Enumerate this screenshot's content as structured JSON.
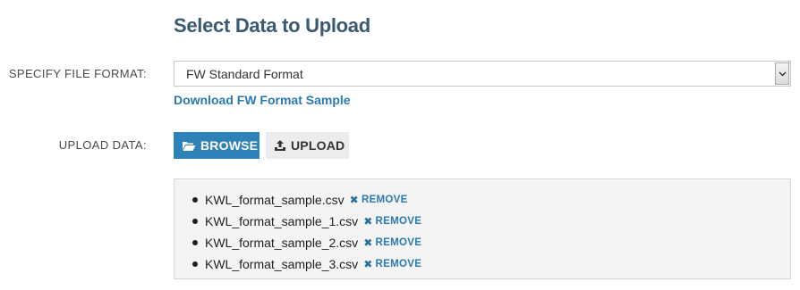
{
  "heading": "Select Data to Upload",
  "format": {
    "label": "SPECIFY FILE FORMAT:",
    "selected": "FW Standard Format",
    "arrow_icon": "chevron-down-icon",
    "download_link": "Download FW Format Sample"
  },
  "upload": {
    "label": "UPLOAD DATA:",
    "browse_label": "BROWSE",
    "browse_icon": "folder-open-icon",
    "upload_label": "UPLOAD",
    "upload_icon": "upload-icon"
  },
  "files": {
    "remove_label": "REMOVE",
    "items": [
      "KWL_format_sample.csv",
      "KWL_format_sample_1.csv",
      "KWL_format_sample_2.csv",
      "KWL_format_sample_3.csv"
    ]
  },
  "colors": {
    "heading": "#3a5a72",
    "link": "#2a7ab0",
    "browse_bg": "#2f82b8",
    "panel_bg": "#f4f4f4"
  }
}
